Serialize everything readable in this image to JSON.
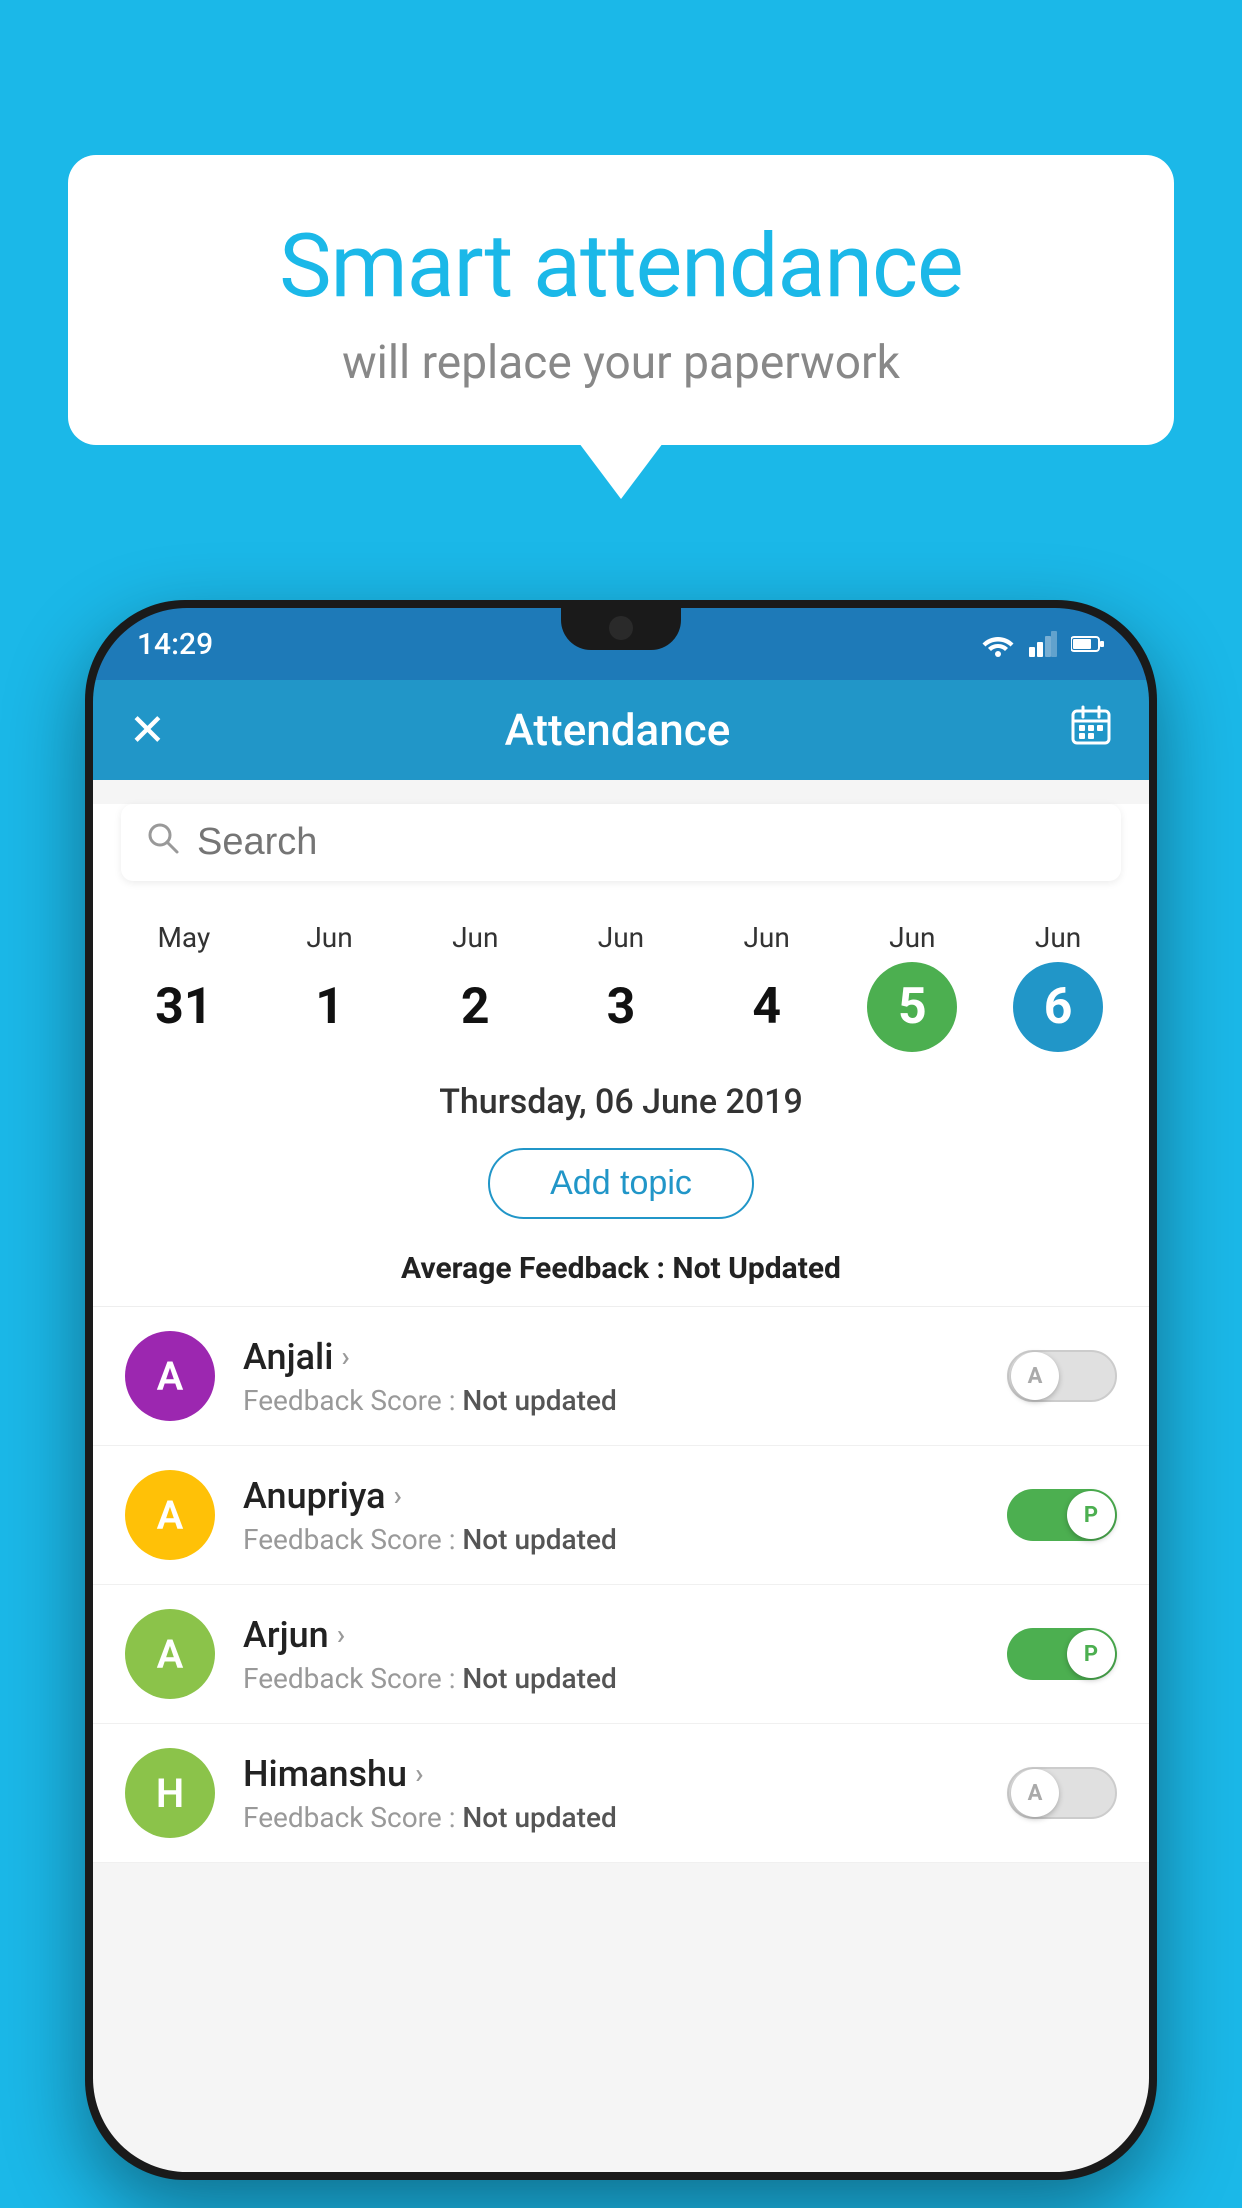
{
  "background_color": "#1bb8e8",
  "bubble": {
    "title": "Smart attendance",
    "subtitle": "will replace your paperwork"
  },
  "phone": {
    "status_bar": {
      "time": "14:29"
    },
    "app_bar": {
      "title": "Attendance",
      "close_icon": "✕",
      "calendar_icon": "📅"
    },
    "search": {
      "placeholder": "Search"
    },
    "calendar": {
      "days": [
        {
          "month": "May",
          "num": "31",
          "style": ""
        },
        {
          "month": "Jun",
          "num": "1",
          "style": ""
        },
        {
          "month": "Jun",
          "num": "2",
          "style": ""
        },
        {
          "month": "Jun",
          "num": "3",
          "style": ""
        },
        {
          "month": "Jun",
          "num": "4",
          "style": ""
        },
        {
          "month": "Jun",
          "num": "5",
          "style": "today"
        },
        {
          "month": "Jun",
          "num": "6",
          "style": "selected"
        }
      ]
    },
    "selected_date": "Thursday, 06 June 2019",
    "add_topic_label": "Add topic",
    "feedback_summary_label": "Average Feedback :",
    "feedback_summary_value": "Not Updated",
    "students": [
      {
        "name": "Anjali",
        "avatar_letter": "A",
        "avatar_color": "#9c27b0",
        "feedback_label": "Feedback Score :",
        "feedback_value": "Not updated",
        "toggle": "off",
        "toggle_letter": "A"
      },
      {
        "name": "Anupriya",
        "avatar_letter": "A",
        "avatar_color": "#ffc107",
        "feedback_label": "Feedback Score :",
        "feedback_value": "Not updated",
        "toggle": "on",
        "toggle_letter": "P"
      },
      {
        "name": "Arjun",
        "avatar_letter": "A",
        "avatar_color": "#8bc34a",
        "feedback_label": "Feedback Score :",
        "feedback_value": "Not updated",
        "toggle": "on",
        "toggle_letter": "P"
      },
      {
        "name": "Himanshu",
        "avatar_letter": "H",
        "avatar_color": "#8bc34a",
        "feedback_label": "Feedback Score :",
        "feedback_value": "Not updated",
        "toggle": "off",
        "toggle_letter": "A"
      }
    ]
  }
}
